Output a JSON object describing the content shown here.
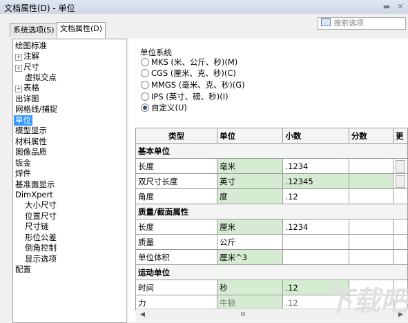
{
  "window": {
    "title": "文档属性(D) - 单位"
  },
  "tabs": [
    {
      "label": "系统选项(S)"
    },
    {
      "label": "文档属性(D)"
    }
  ],
  "search": {
    "placeholder": "搜索选项"
  },
  "tree": {
    "items": [
      {
        "label": "绘图标准"
      },
      {
        "label": "注解"
      },
      {
        "label": "尺寸"
      },
      {
        "label": "虚拟交点"
      },
      {
        "label": "表格"
      },
      {
        "label": "出详图"
      },
      {
        "label": "网格线/捕捉"
      },
      {
        "label": "单位"
      },
      {
        "label": "模型显示"
      },
      {
        "label": "材料属性"
      },
      {
        "label": "图像品质"
      },
      {
        "label": "钣金"
      },
      {
        "label": "焊件"
      },
      {
        "label": "基准面显示"
      },
      {
        "label": "DimXpert"
      },
      {
        "label": "大小尺寸"
      },
      {
        "label": "位置尺寸"
      },
      {
        "label": "尺寸链"
      },
      {
        "label": "形位公差"
      },
      {
        "label": "倒角控制"
      },
      {
        "label": "显示选项"
      },
      {
        "label": "配置"
      }
    ]
  },
  "unit_system": {
    "label": "单位系统",
    "options": [
      {
        "label": "MKS (米、公斤、秒)(M)",
        "selected": false
      },
      {
        "label": "CGS (厘米、克、秒)(C)",
        "selected": false
      },
      {
        "label": "MMGS (毫米、克、秒)(G)",
        "selected": false
      },
      {
        "label": "IPS (英寸、磅、秒)(I)",
        "selected": false
      },
      {
        "label": "自定义(U)",
        "selected": true
      }
    ]
  },
  "table": {
    "headers": [
      "类型",
      "单位",
      "小数",
      "分数",
      "更"
    ],
    "sections": {
      "basic": "基本单位",
      "mass": "质量/截面属性",
      "motion": "运动单位"
    },
    "rows": [
      {
        "type": "长度",
        "unit": "毫米",
        "decimal": ".1234"
      },
      {
        "type": "双尺寸长度",
        "unit": "英寸",
        "decimal": ".12345"
      },
      {
        "type": "角度",
        "unit": "度",
        "decimal": ".12"
      },
      {
        "type": "长度",
        "unit": "厘米",
        "decimal": ".1234"
      },
      {
        "type": "质量",
        "unit": "公斤",
        "decimal": ""
      },
      {
        "type": "单位体积",
        "unit": "厘米^3",
        "decimal": ""
      },
      {
        "type": "时间",
        "unit": "秒",
        "decimal": ".12"
      },
      {
        "type": "力",
        "unit": "牛顿",
        "decimal": ".12"
      }
    ]
  },
  "scrollbar": {
    "thumb_glyph": "III"
  },
  "colors": {
    "selected": "#3399ff",
    "green_cell": "#d6ecd2"
  }
}
